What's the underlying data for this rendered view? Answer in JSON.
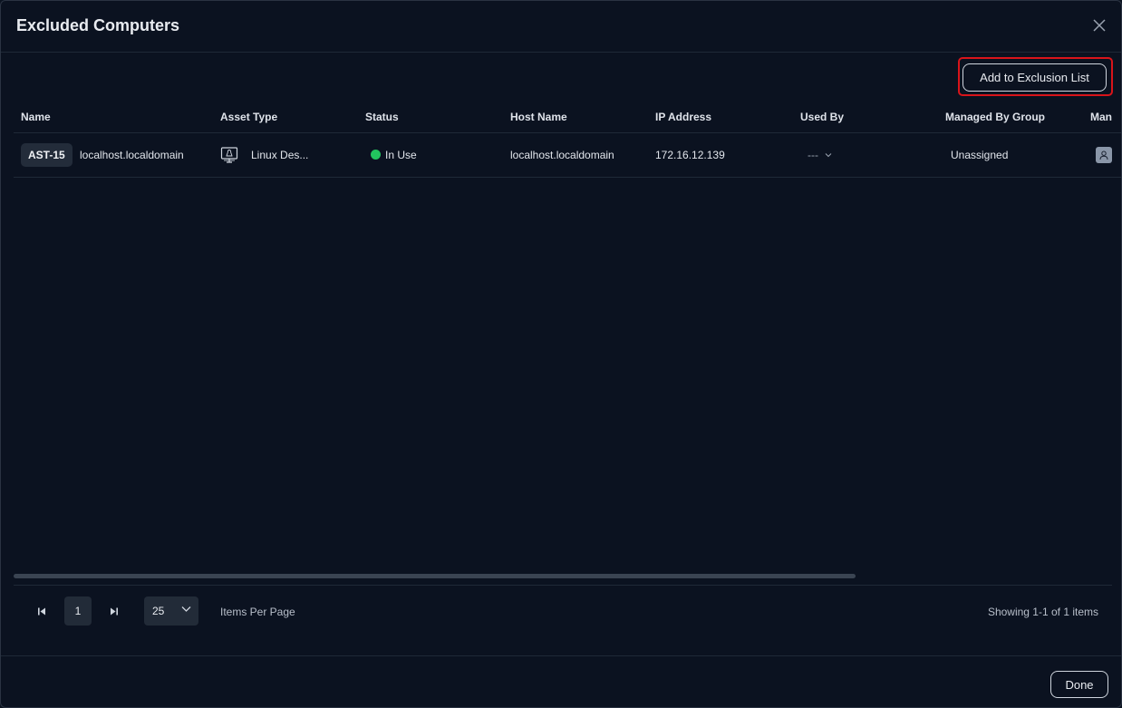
{
  "dialog": {
    "title": "Excluded Computers"
  },
  "toolbar": {
    "add_label": "Add to Exclusion List"
  },
  "table": {
    "columns": [
      "Name",
      "Asset Type",
      "Status",
      "Host Name",
      "IP Address",
      "Used By",
      "Managed By Group",
      "Man"
    ],
    "rows": [
      {
        "asset_tag": "AST-15",
        "name": "localhost.localdomain",
        "asset_type": "Linux Des...",
        "asset_type_icon": "desktop-icon",
        "status": "In Use",
        "status_color": "#22c55e",
        "host_name": "localhost.localdomain",
        "ip_address": "172.16.12.139",
        "used_by": "---",
        "managed_by_group": "Unassigned",
        "managed_by_icon": "user-icon"
      }
    ]
  },
  "pagination": {
    "current_page": "1",
    "page_size": "25",
    "items_per_page_label": "Items Per Page",
    "showing_text": "Showing 1-1 of 1 items"
  },
  "footer": {
    "done_label": "Done"
  },
  "colors": {
    "background": "#0b1220",
    "highlight_border": "#d9141a",
    "status_in_use": "#22c55e"
  }
}
